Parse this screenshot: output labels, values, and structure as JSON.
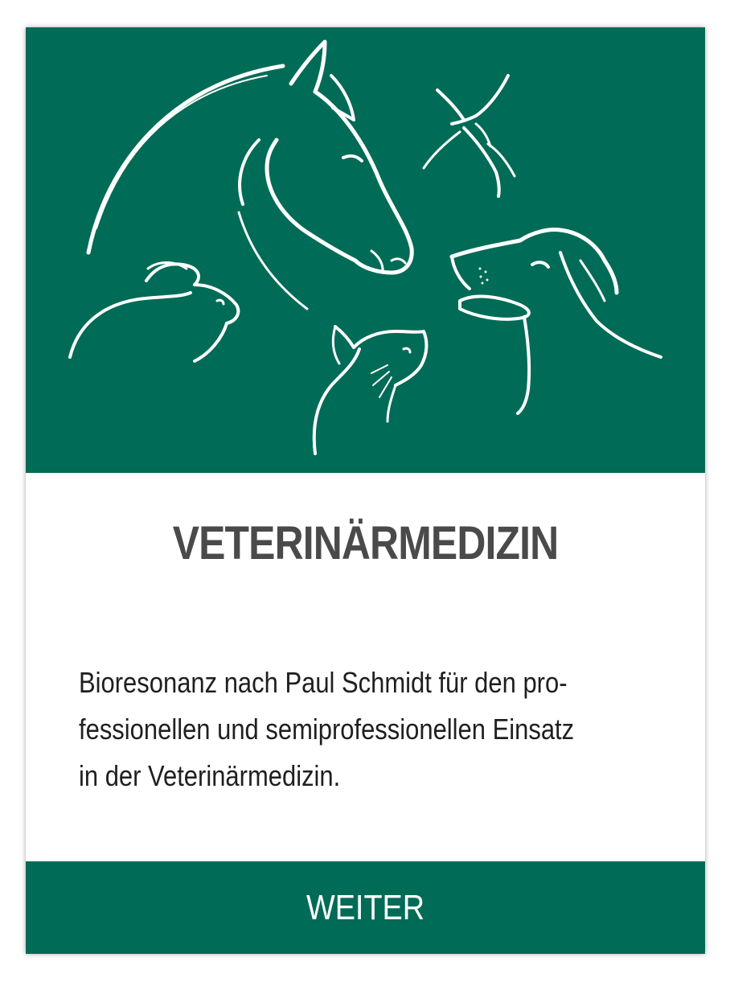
{
  "card": {
    "title": "VETERINÄRMEDIZIN",
    "description_lines": [
      "Bioresonanz nach Paul Schmidt für den pro-",
      "fessionellen und semiprofessionellen Einsatz",
      "in der Veterinärmedizin."
    ],
    "button_label": "WEITER"
  },
  "hero": {
    "illustration_icons": [
      "horse-icon",
      "hummingbird-icon",
      "rabbit-icon",
      "cat-icon",
      "dog-icon"
    ]
  },
  "colors": {
    "brand_green": "#006b56",
    "title_gray": "#4a4a4a",
    "text": "#1f1f1f",
    "background": "#ffffff"
  }
}
